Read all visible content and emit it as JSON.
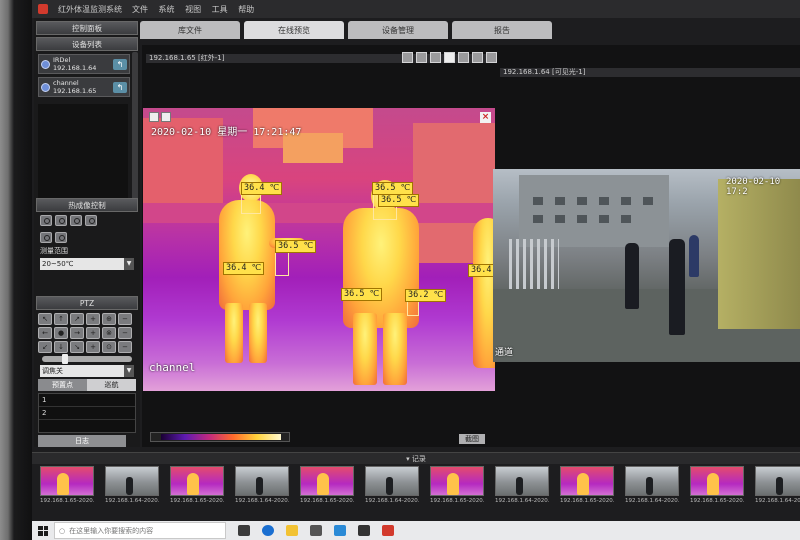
{
  "app": {
    "title": "红外体温监测系统",
    "menu": [
      "文件",
      "系统",
      "视图",
      "工具",
      "帮助"
    ]
  },
  "left_panel": {
    "header": "控制面板",
    "device_list_title": "设备列表",
    "devices": [
      {
        "name": "IRDel",
        "ip": "192.168.1.64"
      },
      {
        "name": "channel",
        "ip": "192.168.1.65"
      }
    ],
    "thermal_control_title": "热成像控制",
    "range_label": "测量范围",
    "range_value": "20~50℃",
    "ptz_title": "PTZ",
    "ptz_buttons": [
      "↖",
      "↑",
      "↗",
      "+",
      "⊕",
      "−",
      "←",
      "●",
      "→",
      "+",
      "⊗",
      "−",
      "↙",
      "↓",
      "↘",
      "+",
      "⊙",
      "−"
    ],
    "focus_select": "调焦关",
    "preset_tabs": [
      "预置点",
      "巡航"
    ],
    "preset_rows": [
      "1",
      "2"
    ],
    "log_button": "日志"
  },
  "tabs": [
    "库文件",
    "在线预览",
    "设备管理",
    "报告"
  ],
  "active_tab": 1,
  "video": {
    "left_cam_label": "192.168.1.65 [红外-1]",
    "right_cam_label": "192.168.1.64 [可见光-1]",
    "thermal": {
      "datetime": "2020-02-10 星期一 17:21:47",
      "channel_name": "channel",
      "temperatures": [
        "36.4 ℃",
        "36.5 ℃",
        "36.5 ℃",
        "36.5 ℃",
        "36.4 ℃",
        "36.5 ℃",
        "36.2 ℃",
        "36.4"
      ]
    },
    "visible": {
      "datetime": "2020-02-10 17:2",
      "channel_name": "通道"
    },
    "snapshot_button": "截图"
  },
  "record": {
    "title": "记录",
    "thumbnails": [
      {
        "kind": "ir",
        "caption": "192.168.1.65-2020..."
      },
      {
        "kind": "vis",
        "caption": "192.168.1.64-2020..."
      },
      {
        "kind": "ir",
        "caption": "192.168.1.65-2020..."
      },
      {
        "kind": "vis",
        "caption": "192.168.1.64-2020..."
      },
      {
        "kind": "ir",
        "caption": "192.168.1.65-2020..."
      },
      {
        "kind": "vis",
        "caption": "192.168.1.64-2020..."
      },
      {
        "kind": "ir",
        "caption": "192.168.1.65-2020..."
      },
      {
        "kind": "vis",
        "caption": "192.168.1.64-2020..."
      },
      {
        "kind": "ir",
        "caption": "192.168.1.65-2020..."
      },
      {
        "kind": "vis",
        "caption": "192.168.1.64-2020..."
      },
      {
        "kind": "ir",
        "caption": "192.168.1.65-2020..."
      },
      {
        "kind": "vis",
        "caption": "192.168.1.64-2020..."
      }
    ]
  },
  "taskbar": {
    "search_placeholder": "在这里输入你要搜索的内容"
  },
  "colors": {
    "accent_label": "#ffe14a",
    "thermal_hot": "#ffd84a",
    "thermal_cold": "#a21fb9"
  }
}
